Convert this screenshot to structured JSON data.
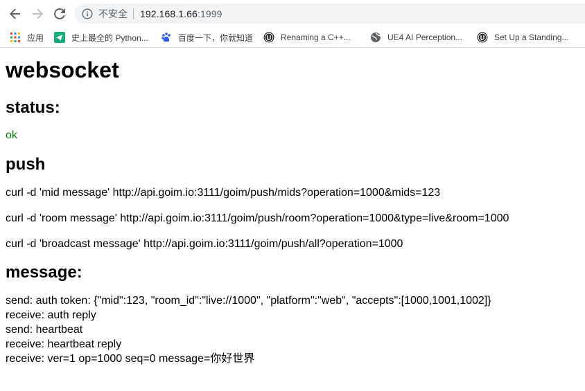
{
  "browser": {
    "security_label": "不安全",
    "url_host": "192.168.1.66",
    "url_port": ":1999",
    "bookmarks": [
      {
        "label": "应用",
        "icon": "apps-grid-icon"
      },
      {
        "label": "史上最全的 Python...",
        "icon": "paper-plane-icon"
      },
      {
        "label": "百度一下，你就知道",
        "icon": "baidu-paw-icon"
      },
      {
        "label": "Renaming a C++...",
        "icon": "unreal-engine-icon"
      },
      {
        "label": "UE4 AI Perception...",
        "icon": "globe-icon"
      },
      {
        "label": "Set Up a Standing...",
        "icon": "unreal-engine-icon"
      }
    ]
  },
  "page": {
    "title": "websocket",
    "status_heading": "status:",
    "status_value": "ok",
    "push_heading": "push",
    "push_commands": [
      "curl -d 'mid message' http://api.goim.io:3111/goim/push/mids?operation=1000&mids=123",
      "curl -d 'room message' http://api.goim.io:3111/goim/push/room?operation=1000&type=live&room=1000",
      "curl -d 'broadcast message' http://api.goim.io:3111/goim/push/all?operation=1000"
    ],
    "message_heading": "message:",
    "messages": [
      "send: auth token: {\"mid\":123, \"room_id\":\"live://1000\", \"platform\":\"web\", \"accepts\":[1000,1001,1002]}",
      "receive: auth reply",
      "send: heartbeat",
      "receive: heartbeat reply",
      "receive: ver=1 op=1000 seq=0 message=你好世界"
    ]
  },
  "colors": {
    "status_ok": "#008000",
    "omnibox_bg": "#f1f3f4"
  }
}
